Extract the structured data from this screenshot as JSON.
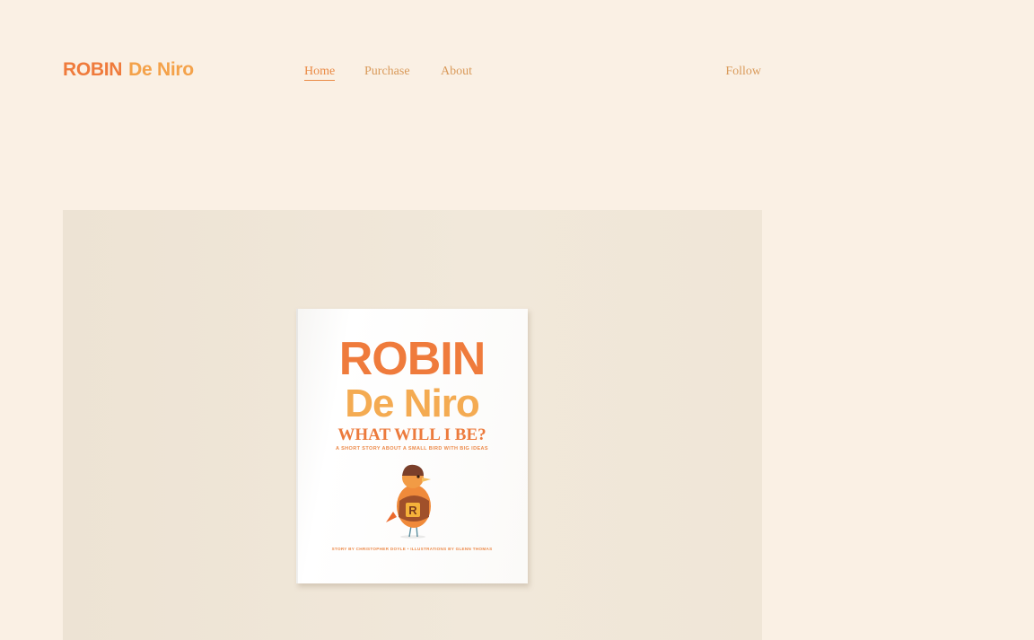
{
  "site": {
    "logo_part1": "ROBIN",
    "logo_part2": "De Niro"
  },
  "nav": {
    "items": [
      {
        "label": "Home",
        "active": true
      },
      {
        "label": "Purchase",
        "active": false
      },
      {
        "label": "About",
        "active": false
      }
    ],
    "follow": "Follow"
  },
  "hero": {
    "book": {
      "title_line1": "ROBIN",
      "title_line2": "De Niro",
      "subtitle": "WHAT WILL I BE?",
      "tagline": "A SHORT STORY ABOUT A SMALL BIRD WITH BIG IDEAS",
      "credits": "STORY BY CHRISTOPHER DOYLE • ILLUSTRATIONS BY GLENN THOMAS",
      "sweater_letter": "R"
    }
  },
  "colors": {
    "background": "#faf0e4",
    "accent_orange": "#ef7b3c",
    "accent_yellow": "#f4a24a",
    "nav_text": "#d99a5a"
  }
}
